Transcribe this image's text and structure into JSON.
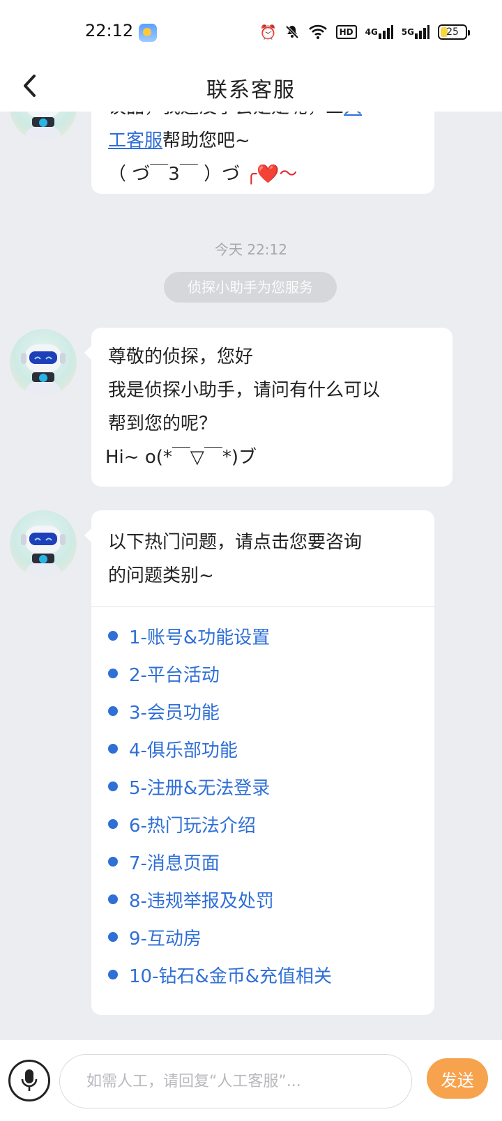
{
  "status_bar": {
    "time": "22:12",
    "battery": "25",
    "hd_label": "HD",
    "sig1_label": "4G",
    "sig2_label": "5G"
  },
  "header": {
    "title": "联系客服",
    "back_glyph": "❮"
  },
  "chat": {
    "prev_message": {
      "line1": "议品，我还没学会是是呢，三",
      "line1_link": "人",
      "line2_link": "工客服",
      "line2_rest": "帮助您吧~",
      "line3": "（ づ￣3￣ ）づ",
      "line3_heart": "╭❤️～"
    },
    "timestamp": "今天 22:12",
    "system_notice": "侦探小助手为您服务",
    "greeting": {
      "line1": "尊敬的侦探，您好",
      "line2": "我是侦探小助手，请问有什么可以",
      "line3": "帮到您的呢？",
      "line4": "Hi~ o(*￣▽￣*)ブ"
    },
    "faq": {
      "intro_line1": "以下热门问题，请点击您要咨询",
      "intro_line2": "的问题类别~",
      "items": [
        "1-账号&功能设置",
        "2-平台活动",
        "3-会员功能",
        "4-俱乐部功能",
        "5-注册&无法登录",
        "6-热门玩法介绍",
        "7-消息页面",
        "8-违规举报及处罚",
        "9-互动房",
        "10-钻石&金币&充值相关"
      ]
    }
  },
  "input_bar": {
    "placeholder": "如需人工，请回复“人工客服”...",
    "send_label": "发送"
  },
  "colors": {
    "link_blue": "#2f6fd6",
    "send_orange": "#f7a24d",
    "background": "#ecedf1"
  }
}
